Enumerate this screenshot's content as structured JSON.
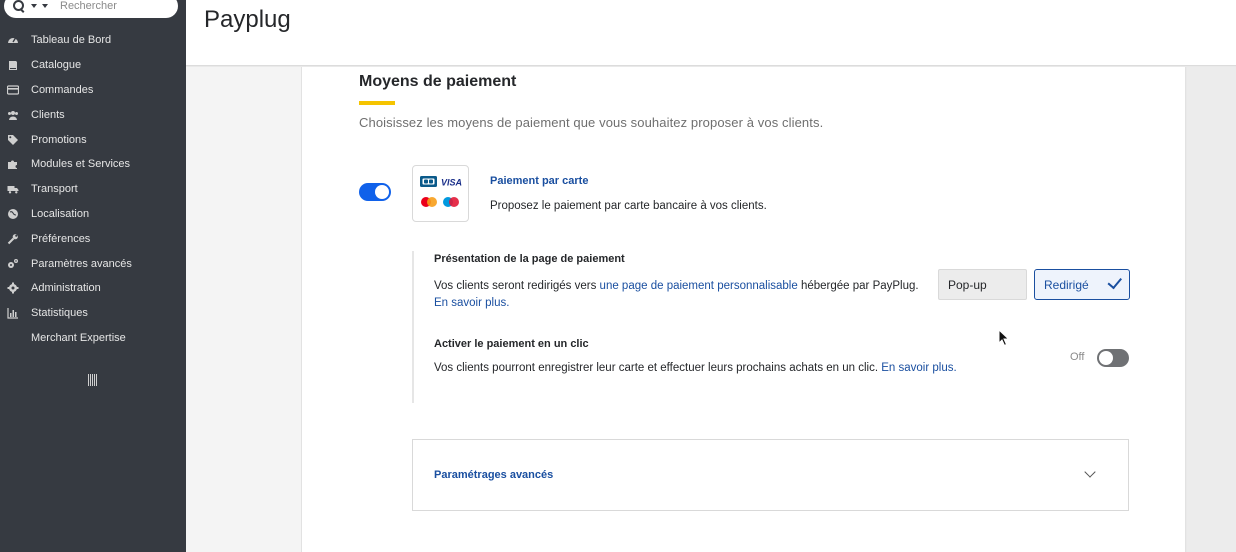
{
  "sidebar": {
    "search_placeholder": "Rechercher",
    "items": [
      {
        "label": "Tableau de Bord",
        "icon": "dashboard-icon"
      },
      {
        "label": "Catalogue",
        "icon": "book-icon"
      },
      {
        "label": "Commandes",
        "icon": "credit-card-icon"
      },
      {
        "label": "Clients",
        "icon": "users-icon"
      },
      {
        "label": "Promotions",
        "icon": "tags-icon"
      },
      {
        "label": "Modules et Services",
        "icon": "puzzle-icon"
      },
      {
        "label": "Transport",
        "icon": "truck-icon"
      },
      {
        "label": "Localisation",
        "icon": "globe-icon"
      },
      {
        "label": "Préférences",
        "icon": "wrench-icon"
      },
      {
        "label": "Paramètres avancés",
        "icon": "cogs-icon"
      },
      {
        "label": "Administration",
        "icon": "gear-icon"
      },
      {
        "label": "Statistiques",
        "icon": "bar-chart-icon"
      },
      {
        "label": "Merchant Expertise",
        "icon": ""
      }
    ]
  },
  "header": {
    "title": "Payplug"
  },
  "section": {
    "title": "Moyens de paiement",
    "description": "Choisissez les moyens de paiement que vous souhaitez proposer à vos clients.",
    "accent_color": "#f5c400"
  },
  "card_payment": {
    "enabled": true,
    "title": "Paiement par carte",
    "description": "Proposez le paiement par carte bancaire à vos clients.",
    "logo_text": "VISA"
  },
  "presentation": {
    "title": "Présentation de la page de paiement",
    "desc_before": "Vos clients seront redirigés vers ",
    "desc_link": "une page de paiement personnalisable",
    "desc_after": " hébergée par PayPlug. ",
    "learn_more": "En savoir plus.",
    "options": [
      "Pop-up",
      "Redirigé"
    ],
    "selected": "Redirigé"
  },
  "one_click": {
    "title": "Activer le paiement en un clic",
    "desc": "Vos clients pourront enregistrer leur carte et effectuer leurs prochains achats en un clic. ",
    "learn_more": "En savoir plus.",
    "state_label": "Off",
    "enabled": false
  },
  "advanced": {
    "title": "Paramétrages avancés"
  },
  "colors": {
    "primary": "#1061ea",
    "link": "#1a4fa0",
    "sidebar": "#363a41"
  }
}
